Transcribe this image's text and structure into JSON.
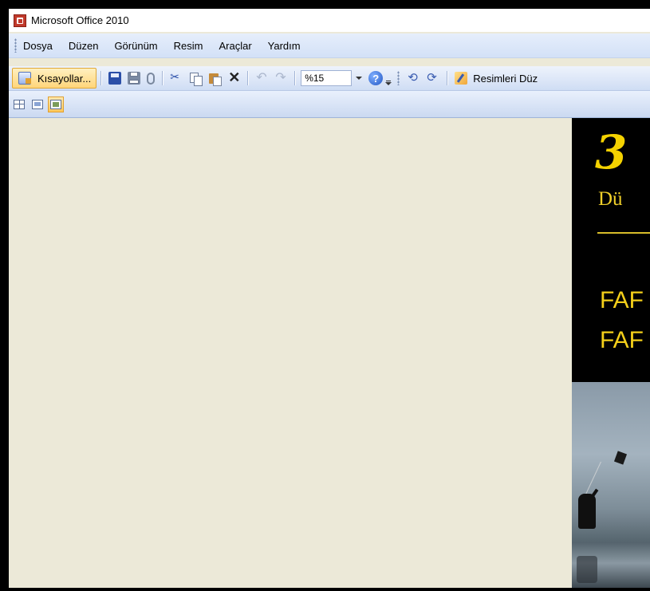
{
  "window": {
    "title": "Microsoft Office 2010"
  },
  "menubar": {
    "items": [
      {
        "label": "Dosya"
      },
      {
        "label": "Düzen"
      },
      {
        "label": "Görünüm"
      },
      {
        "label": "Resim"
      },
      {
        "label": "Araçlar"
      },
      {
        "label": "Yardım"
      }
    ]
  },
  "toolbar": {
    "shortcuts_label": "Kısayollar...",
    "zoom_value": "%15",
    "edit_pictures_label": "Resimleri Düz",
    "icons": [
      "save-icon",
      "print-icon",
      "attach-icon",
      "cut-icon",
      "copy-icon",
      "paste-icon",
      "delete-icon",
      "undo-icon",
      "redo-icon",
      "help-icon",
      "rotate-left-icon",
      "rotate-right-icon",
      "edit-pictures-icon"
    ]
  },
  "viewbar": {
    "modes": [
      "thumbnail-view",
      "filmstrip-view",
      "single-picture-view"
    ],
    "active_mode": "single-picture-view"
  },
  "image_preview": {
    "line1": "3",
    "line2": "Dü",
    "line3": "FAF",
    "line4": "FAF"
  },
  "colors": {
    "accent_hover": "#ffd57a",
    "toolbar_bg": "#d3e1f7",
    "workspace_bg": "#ece9d8",
    "image_text": "#f4d200"
  }
}
